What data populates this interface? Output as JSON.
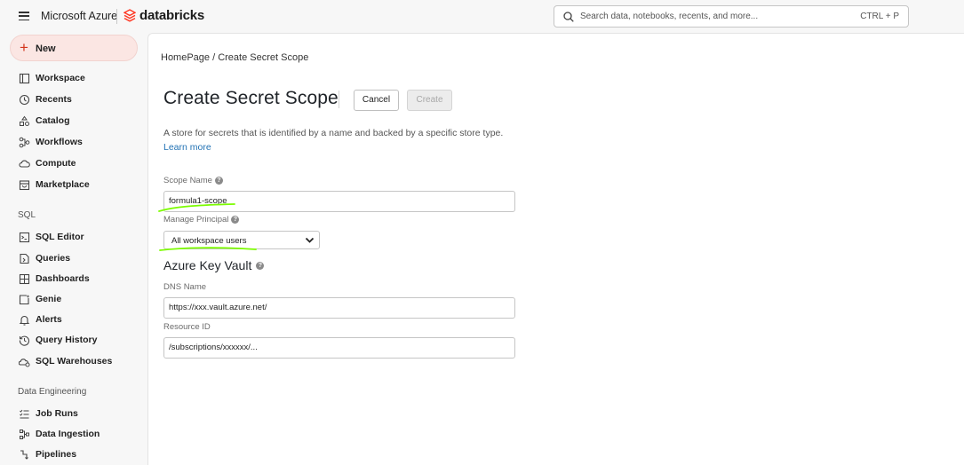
{
  "topbar": {
    "provider": "Microsoft Azure",
    "product": "databricks",
    "search_placeholder": "Search data, notebooks, recents, and more...",
    "search_shortcut": "CTRL + P"
  },
  "sidebar": {
    "new_label": "New",
    "items": [
      {
        "label": "Workspace",
        "icon": "folder-icon"
      },
      {
        "label": "Recents",
        "icon": "clock-icon"
      },
      {
        "label": "Catalog",
        "icon": "catalog-icon"
      },
      {
        "label": "Workflows",
        "icon": "workflows-icon"
      },
      {
        "label": "Compute",
        "icon": "cloud-icon"
      },
      {
        "label": "Marketplace",
        "icon": "store-icon"
      }
    ],
    "sql_section": "SQL",
    "sql_items": [
      {
        "label": "SQL Editor",
        "icon": "sql-editor-icon"
      },
      {
        "label": "Queries",
        "icon": "query-icon"
      },
      {
        "label": "Dashboards",
        "icon": "dashboard-icon"
      },
      {
        "label": "Genie",
        "icon": "genie-icon"
      },
      {
        "label": "Alerts",
        "icon": "bell-icon"
      },
      {
        "label": "Query History",
        "icon": "history-icon"
      },
      {
        "label": "SQL Warehouses",
        "icon": "warehouse-icon"
      }
    ],
    "de_section": "Data Engineering",
    "de_items": [
      {
        "label": "Job Runs",
        "icon": "job-runs-icon"
      },
      {
        "label": "Data Ingestion",
        "icon": "ingestion-icon"
      },
      {
        "label": "Pipelines",
        "icon": "pipeline-icon"
      }
    ]
  },
  "main": {
    "breadcrumb": "HomePage / Create Secret Scope",
    "title": "Create Secret Scope",
    "cancel_label": "Cancel",
    "create_label": "Create",
    "description": "A store for secrets that is identified by a name and backed by a specific store type.",
    "learn_more": "Learn more",
    "scope_name_label": "Scope Name",
    "scope_name_value": "formula1-scope",
    "manage_principal_label": "Manage Principal",
    "manage_principal_value": "All workspace users",
    "key_vault_heading": "Azure Key Vault",
    "dns_name_label": "DNS Name",
    "dns_name_value": "https://xxx.vault.azure.net/",
    "resource_id_label": "Resource ID",
    "resource_id_value": "/subscriptions/xxxxxx/..."
  },
  "colors": {
    "brand": "#ff3621",
    "link": "#2272b4",
    "annotation": "#7cfc00"
  }
}
